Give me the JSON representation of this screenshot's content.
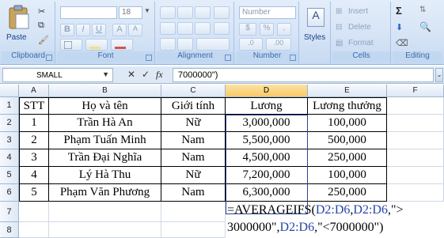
{
  "ribbon": {
    "clipboard": {
      "label": "Clipboard",
      "paste_label": "Paste"
    },
    "font": {
      "label": "Font",
      "size": "18",
      "bold": "B",
      "italic": "I",
      "underline": "U",
      "grow": "A",
      "shrink": "A"
    },
    "alignment": {
      "label": "Alignment"
    },
    "number": {
      "label": "Number",
      "format": "Number",
      "currency": "$",
      "percent": "%",
      "comma": ",",
      "inc_decimal": ".0",
      "dec_decimal": ".00"
    },
    "styles": {
      "label": "Styles"
    },
    "cells": {
      "label": "Cells",
      "insert": "Insert",
      "delete": "Delete",
      "format": "Format"
    },
    "editing": {
      "label": "Editing",
      "sigma": "Σ"
    }
  },
  "formula_bar": {
    "name_box": "SMALL",
    "fx": "fx",
    "value": "7000000\")"
  },
  "columns": [
    "A",
    "B",
    "C",
    "D",
    "E",
    "F"
  ],
  "rows": [
    "1",
    "2",
    "3",
    "4",
    "5",
    "6",
    "7",
    "8"
  ],
  "table": {
    "headers": [
      "STT",
      "Họ và tên",
      "Giới tính",
      "Lương",
      "Lương thưởng"
    ],
    "rows": [
      [
        "1",
        "Trần Hà An",
        "Nữ",
        "3,000,000",
        "100,000"
      ],
      [
        "2",
        "Phạm Tuấn Minh",
        "Nam",
        "5,500,000",
        "500,000"
      ],
      [
        "3",
        "Trần Đại Nghĩa",
        "Nam",
        "4,500,000",
        "250,000"
      ],
      [
        "4",
        "Lý Hà Thu",
        "Nữ",
        "7,200,000",
        "100,000"
      ],
      [
        "5",
        "Phạm Văn Phương",
        "Nam",
        "6,300,000",
        "250,000"
      ]
    ]
  },
  "formula_cell": {
    "line1_a": "=AVERAGEIFS(",
    "line1_ref1": "D2:D6",
    "line1_b": ",",
    "line1_ref2": "D2:D6",
    "line1_c": ",\">",
    "line2_a": "3000000\",",
    "line2_ref": "D2:D6",
    "line2_b": ",\"<7000000\")"
  }
}
